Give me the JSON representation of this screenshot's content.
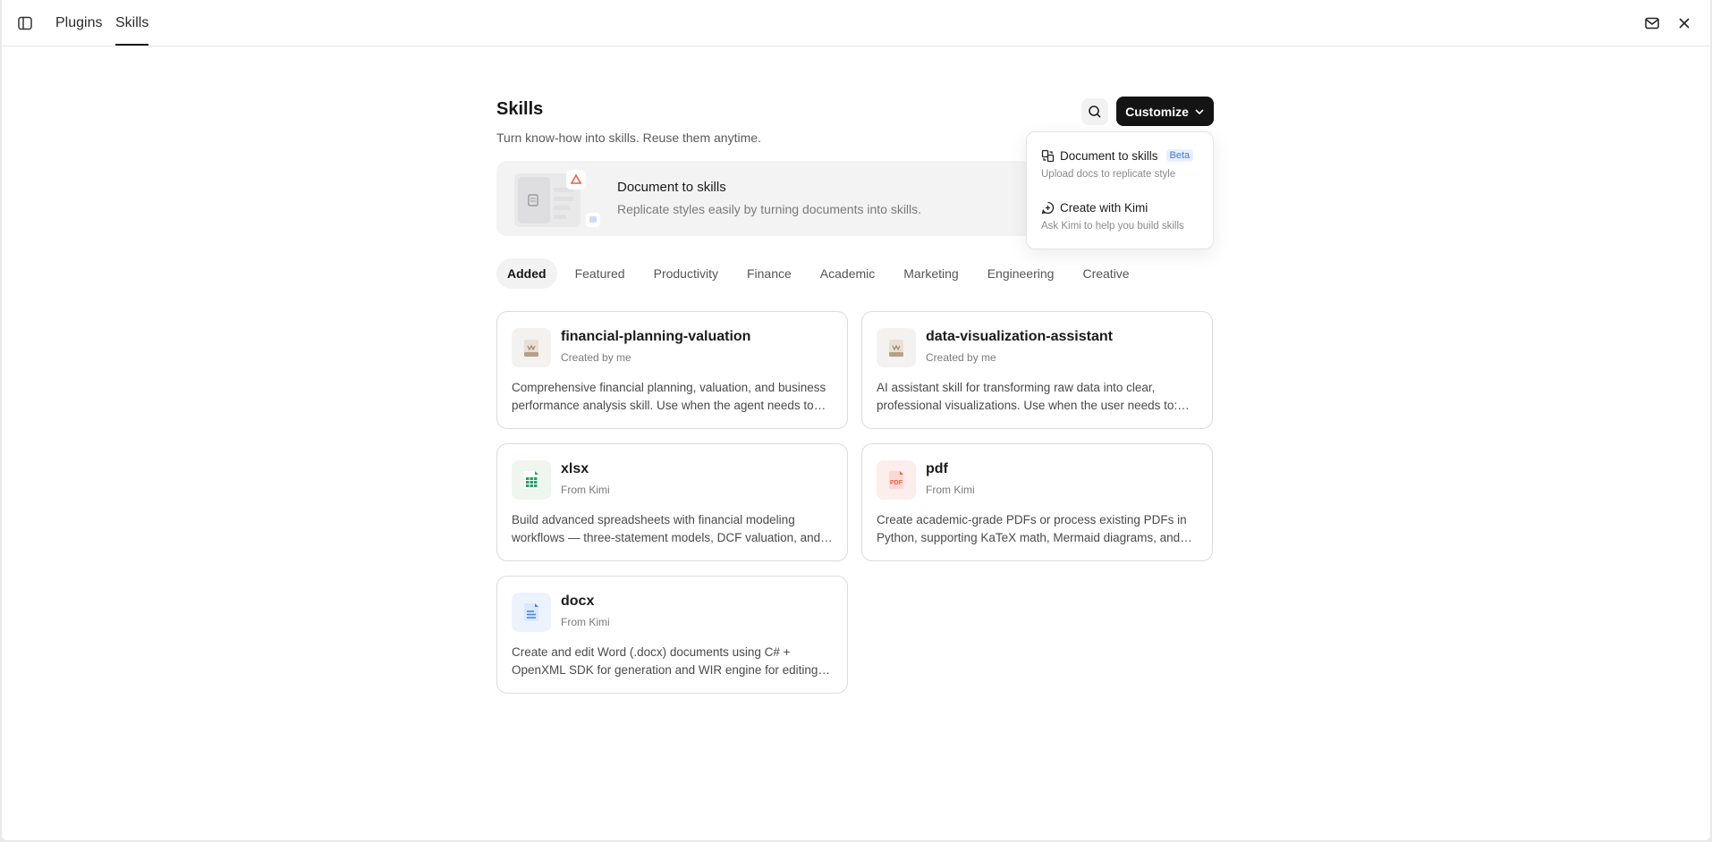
{
  "nav": {
    "tabs": [
      {
        "label": "Plugins"
      },
      {
        "label": "Skills"
      }
    ]
  },
  "header": {
    "title": "Skills",
    "subtitle": "Turn know-how into skills. Reuse them anytime.",
    "customize_label": "Customize"
  },
  "banner": {
    "title": "Document to skills",
    "description": "Replicate styles easily by turning documents into skills."
  },
  "dropdown": {
    "items": [
      {
        "label": "Document to skills",
        "badge": "Beta",
        "description": "Upload docs to replicate style",
        "icon": "document-convert-icon"
      },
      {
        "label": "Create with Kimi",
        "description": "Ask Kimi to help you build skills",
        "icon": "kimi-chat-icon"
      }
    ]
  },
  "categories": [
    "Added",
    "Featured",
    "Productivity",
    "Finance",
    "Academic",
    "Marketing",
    "Engineering",
    "Creative"
  ],
  "active_category": "Added",
  "cards": [
    {
      "title": "financial-planning-valuation",
      "source": "Created by me",
      "description": "Comprehensive financial planning, valuation, and business performance analysis skill. Use when the agent needs to perform financial analysis.",
      "icon": "scroll-icon"
    },
    {
      "title": "data-visualization-assistant",
      "source": "Created by me",
      "description": "AI assistant skill for transforming raw data into clear, professional visualizations. Use when the user needs to: create charts.",
      "icon": "scroll-icon"
    },
    {
      "title": "xlsx",
      "source": "From Kimi",
      "description": "Build advanced spreadsheets with financial modeling workflows — three-statement models, DCF valuation, and more.",
      "icon": "spreadsheet-icon"
    },
    {
      "title": "pdf",
      "source": "From Kimi",
      "description": "Create academic-grade PDFs or process existing PDFs in Python, supporting KaTeX math, Mermaid diagrams, and more.",
      "icon": "pdf-icon"
    },
    {
      "title": "docx",
      "source": "From Kimi",
      "description": "Create and edit Word (.docx) documents using C# + OpenXML SDK for generation and WIR engine for editing documents.",
      "icon": "word-doc-icon"
    }
  ],
  "icon_labels": {
    "pdf": "PDF"
  },
  "colors": {
    "accent": "#141414",
    "beta": "#3d7bd9",
    "xlsx": "#21a366",
    "pdf": "#e8604c",
    "docx": "#3b82f6"
  }
}
